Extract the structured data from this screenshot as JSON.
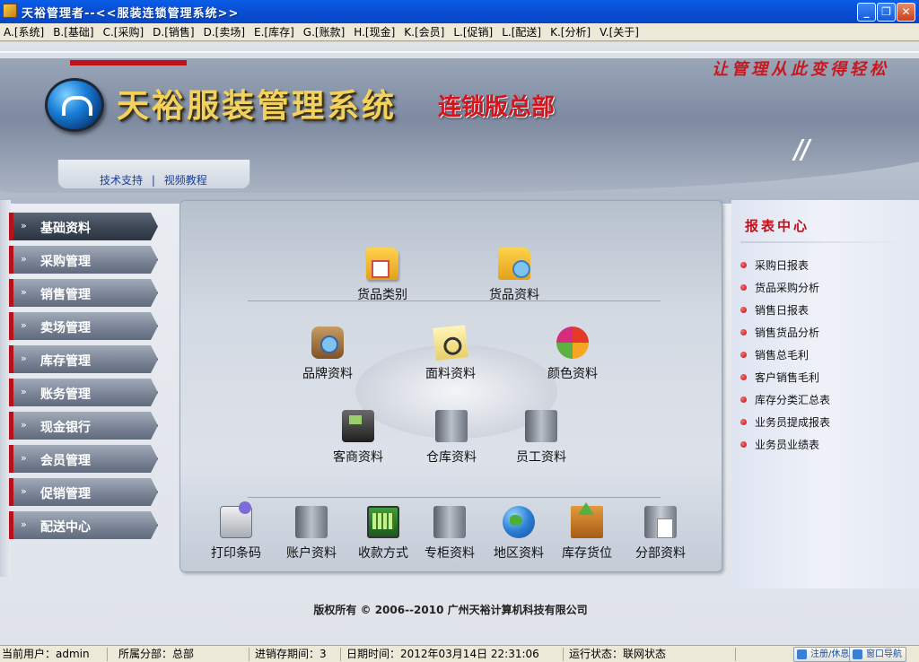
{
  "window": {
    "title": "天裕管理者--<<服装连锁管理系统>>",
    "min_label": "_",
    "max_label": "❐",
    "close_label": "✕"
  },
  "menu": [
    "A.[系统]",
    "B.[基础]",
    "C.[采购]",
    "D.[销售]",
    "D.[卖场]",
    "E.[库存]",
    "G.[账款]",
    "H.[现金]",
    "K.[会员]",
    "L.[促销]",
    "L.[配送]",
    "K.[分析]",
    "V.[关于]"
  ],
  "header": {
    "system_title": "天裕服装管理系统",
    "edition": "连锁版总部",
    "slogan": "让管理从此变得轻松",
    "support_link": "技术支持",
    "separator": "|",
    "video_link": "视频教程"
  },
  "nav": [
    "基础资料",
    "采购管理",
    "销售管理",
    "卖场管理",
    "库存管理",
    "账务管理",
    "现金银行",
    "会员管理",
    "促销管理",
    "配送中心"
  ],
  "nav_arrow": "»",
  "center": {
    "row1": [
      {
        "label": "货品类别",
        "icon": "folder-calendar-icon"
      },
      {
        "label": "货品资料",
        "icon": "folder-search-icon"
      }
    ],
    "row2": [
      {
        "label": "品牌资料",
        "icon": "bag-magnifier-icon"
      },
      {
        "label": "面料资料",
        "icon": "note-magnifier-icon"
      },
      {
        "label": "颜色资料",
        "icon": "color-apple-icon"
      }
    ],
    "row3": [
      {
        "label": "客商资料",
        "icon": "phone-icon"
      },
      {
        "label": "仓库资料",
        "icon": "warehouse-server-icon"
      },
      {
        "label": "员工资料",
        "icon": "staff-server-icon"
      }
    ],
    "row4": [
      {
        "label": "打印条码",
        "icon": "printer-icon"
      },
      {
        "label": "账户资料",
        "icon": "account-server-icon"
      },
      {
        "label": "收款方式",
        "icon": "cash-register-icon"
      },
      {
        "label": "专柜资料",
        "icon": "counter-server-icon"
      },
      {
        "label": "地区资料",
        "icon": "globe-icon"
      },
      {
        "label": "库存货位",
        "icon": "stock-box-icon"
      },
      {
        "label": "分部资料",
        "icon": "branch-docs-icon"
      }
    ]
  },
  "report": {
    "title": "报表中心",
    "items": [
      "采购日报表",
      "货品采购分析",
      "销售日报表",
      "销售货品分析",
      "销售总毛利",
      "客户销售毛利",
      "库存分类汇总表",
      "业务员提成报表",
      "业务员业绩表"
    ]
  },
  "copyright": "版权所有 © 2006--2010 广州天裕计算机科技有限公司",
  "status": {
    "user": "当前用户：admin",
    "branch": "所属分部：总部",
    "period": "进销存期间：3",
    "datetime": "日期时间：2012年03月14日  22:31:06",
    "state": "运行状态：联网状态",
    "lock_btn": "注册/休息",
    "nav_btn": "窗口导航"
  }
}
